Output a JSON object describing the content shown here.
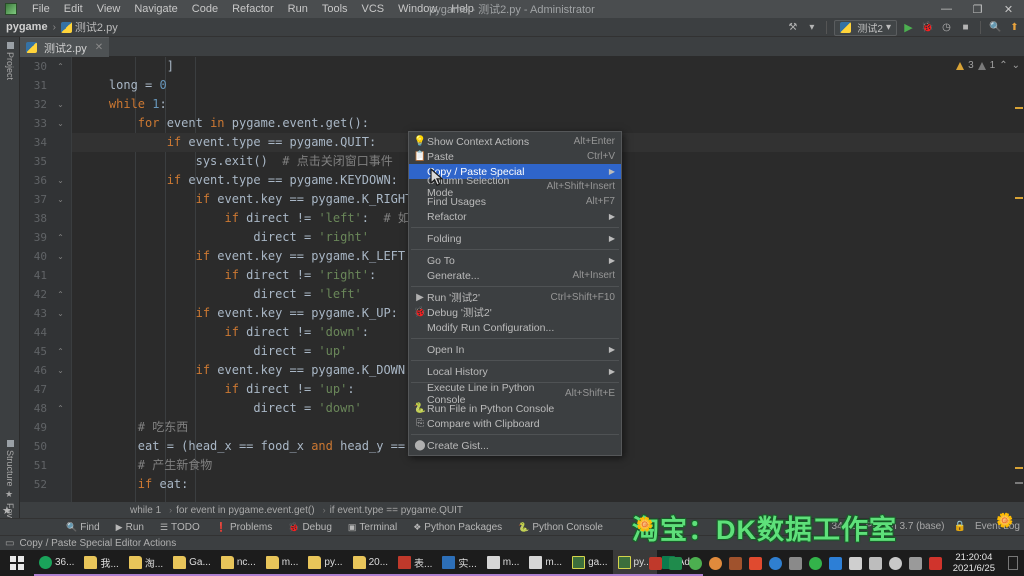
{
  "window": {
    "title": "pygame - 测试2.py - Administrator",
    "controls": {
      "minimize": "—",
      "maximize": "❐",
      "close": "✕"
    }
  },
  "menubar": {
    "items": [
      "File",
      "Edit",
      "View",
      "Navigate",
      "Code",
      "Refactor",
      "Run",
      "Tools",
      "VCS",
      "Window",
      "Help"
    ]
  },
  "breadcrumb": {
    "project": "pygame",
    "separator": "›",
    "file": "测试2.py"
  },
  "toolbar": {
    "run_config": "测试2",
    "chevron": "▾",
    "run_icon": "▶",
    "debug_icon": "🐞",
    "coverage_icon": "◷",
    "stop_icon": "■",
    "search_icon": "🔍",
    "update_icon": "⬆",
    "vcs_icon": "⚒"
  },
  "tabs": [
    {
      "label": "测试2.py",
      "close": "✕",
      "active": true
    }
  ],
  "left_tool_strip": {
    "top": "Project",
    "bottom": [
      "Structure",
      "Favorites"
    ]
  },
  "editor": {
    "inspection": {
      "warning_count": "3",
      "weak_count": "1",
      "up": "⌃",
      "down": "⌄"
    },
    "lines": [
      {
        "num": "30",
        "fold": "⌃",
        "text": "            ]"
      },
      {
        "num": "31",
        "fold": "",
        "text": "    long = 0"
      },
      {
        "num": "32",
        "fold": "⌄",
        "text": "    while 1:"
      },
      {
        "num": "33",
        "fold": "⌄",
        "text": "        for event in pygame.event.get():"
      },
      {
        "num": "34",
        "fold": "",
        "text": "            if event.type == pygame.QUIT:",
        "current": true
      },
      {
        "num": "35",
        "fold": "",
        "text": "                sys.exit()  # 点击关闭窗口事件"
      },
      {
        "num": "36",
        "fold": "⌄",
        "text": "            if event.type == pygame.KEYDOWN:   # 键"
      },
      {
        "num": "37",
        "fold": "⌄",
        "text": "                if event.key == pygame.K_RIGHT:"
      },
      {
        "num": "38",
        "fold": "",
        "text": "                    if direct != 'left':  # 如果蛇"
      },
      {
        "num": "39",
        "fold": "⌃",
        "text": "                        direct = 'right'"
      },
      {
        "num": "40",
        "fold": "⌄",
        "text": "                if event.key == pygame.K_LEFT:"
      },
      {
        "num": "41",
        "fold": "",
        "text": "                    if direct != 'right':"
      },
      {
        "num": "42",
        "fold": "⌃",
        "text": "                        direct = 'left'"
      },
      {
        "num": "43",
        "fold": "⌄",
        "text": "                if event.key == pygame.K_UP:"
      },
      {
        "num": "44",
        "fold": "",
        "text": "                    if direct != 'down':"
      },
      {
        "num": "45",
        "fold": "⌃",
        "text": "                        direct = 'up'"
      },
      {
        "num": "46",
        "fold": "⌄",
        "text": "                if event.key == pygame.K_DOWN:"
      },
      {
        "num": "47",
        "fold": "",
        "text": "                    if direct != 'up':"
      },
      {
        "num": "48",
        "fold": "⌃",
        "text": "                        direct = 'down'"
      },
      {
        "num": "49",
        "fold": "",
        "text": "        # 吃东西"
      },
      {
        "num": "50",
        "fold": "",
        "text": "        eat = (head_x == food_x and head_y == food_y)  # 是否吃到食物"
      },
      {
        "num": "51",
        "fold": "",
        "text": "        # 产生新食物"
      },
      {
        "num": "52",
        "fold": "",
        "text": "        if eat:"
      }
    ]
  },
  "context_menu": {
    "items": [
      {
        "icon": "💡",
        "label": "Show Context Actions",
        "accel": "Alt+Enter",
        "arrow": "",
        "selected": false,
        "sep_after": false
      },
      {
        "icon": "📋",
        "label": "Paste",
        "accel": "Ctrl+V",
        "arrow": "",
        "selected": false,
        "sep_after": false
      },
      {
        "icon": "",
        "label": "Copy / Paste Special",
        "accel": "",
        "arrow": "▶",
        "selected": true,
        "sep_after": false
      },
      {
        "icon": "",
        "label": "Column Selection Mode",
        "accel": "Alt+Shift+Insert",
        "arrow": "",
        "selected": false,
        "sep_after": false
      },
      {
        "icon": "",
        "label": "Find Usages",
        "accel": "Alt+F7",
        "arrow": "",
        "selected": false,
        "sep_after": false
      },
      {
        "icon": "",
        "label": "Refactor",
        "accel": "",
        "arrow": "▶",
        "selected": false,
        "sep_after": true
      },
      {
        "icon": "",
        "label": "Folding",
        "accel": "",
        "arrow": "▶",
        "selected": false,
        "sep_after": true
      },
      {
        "icon": "",
        "label": "Go To",
        "accel": "",
        "arrow": "▶",
        "selected": false,
        "sep_after": false
      },
      {
        "icon": "",
        "label": "Generate...",
        "accel": "Alt+Insert",
        "arrow": "",
        "selected": false,
        "sep_after": true
      },
      {
        "icon": "▶",
        "label": "Run '测试2'",
        "accel": "Ctrl+Shift+F10",
        "arrow": "",
        "selected": false,
        "sep_after": false
      },
      {
        "icon": "🐞",
        "label": "Debug '测试2'",
        "accel": "",
        "arrow": "",
        "selected": false,
        "sep_after": false
      },
      {
        "icon": "",
        "label": "Modify Run Configuration...",
        "accel": "",
        "arrow": "",
        "selected": false,
        "sep_after": true
      },
      {
        "icon": "",
        "label": "Open In",
        "accel": "",
        "arrow": "▶",
        "selected": false,
        "sep_after": true
      },
      {
        "icon": "",
        "label": "Local History",
        "accel": "",
        "arrow": "▶",
        "selected": false,
        "sep_after": true
      },
      {
        "icon": "",
        "label": "Execute Line in Python Console",
        "accel": "Alt+Shift+E",
        "arrow": "",
        "selected": false,
        "sep_after": false
      },
      {
        "icon": "🐍",
        "label": "Run File in Python Console",
        "accel": "",
        "arrow": "",
        "selected": false,
        "sep_after": false
      },
      {
        "icon": "⎘",
        "label": "Compare with Clipboard",
        "accel": "",
        "arrow": "",
        "selected": false,
        "sep_after": true
      },
      {
        "icon": "⬤",
        "label": "Create Gist...",
        "accel": "",
        "arrow": "",
        "selected": false,
        "sep_after": false
      }
    ]
  },
  "watermark": {
    "text": "淘宝：DK数据工作室",
    "flower": "🌼"
  },
  "bottom_breadcrumb": {
    "segments": [
      "while 1",
      "for event in pygame.event.get()",
      "if event.type == pygame.QUIT"
    ],
    "separator": "›",
    "star": "★"
  },
  "tool_buttons": [
    {
      "icon": "🔍",
      "label": "Find"
    },
    {
      "icon": "▶",
      "label": "Run"
    },
    {
      "icon": "☰",
      "label": "TODO"
    },
    {
      "icon": "❗",
      "label": "Problems"
    },
    {
      "icon": "🐞",
      "label": "Debug"
    },
    {
      "icon": "▣",
      "label": "Terminal"
    },
    {
      "icon": "❖",
      "label": "Python Packages"
    },
    {
      "icon": "🐍",
      "label": "Python Console"
    }
  ],
  "status": {
    "hint": "Copy / Paste Special Editor Actions",
    "hint_icon": "▭",
    "caret": "34:38",
    "interpreter": "Python 3.7 (base)",
    "lock_icon": "🔒",
    "event_log": "Event Log"
  },
  "taskbar": {
    "items": [
      {
        "label": "36...",
        "icon_color": "#1aa35a",
        "type": "browser"
      },
      {
        "label": "我...",
        "icon_color": "#e8c55a",
        "type": "folder"
      },
      {
        "label": "淘...",
        "icon_color": "#e8c55a",
        "type": "folder"
      },
      {
        "label": "Ga...",
        "icon_color": "#e8c55a",
        "type": "folder"
      },
      {
        "label": "nc...",
        "icon_color": "#e8c55a",
        "type": "folder"
      },
      {
        "label": "m...",
        "icon_color": "#e8c55a",
        "type": "folder"
      },
      {
        "label": "py...",
        "icon_color": "#e8c55a",
        "type": "folder"
      },
      {
        "label": "20...",
        "icon_color": "#e8c55a",
        "type": "folder"
      },
      {
        "label": "表...",
        "icon_color": "#c0392b",
        "type": "app"
      },
      {
        "label": "实...",
        "icon_color": "#2d6fb8",
        "type": "app"
      },
      {
        "label": "m...",
        "icon_color": "#d6d6d6",
        "type": "doc"
      },
      {
        "label": "m...",
        "icon_color": "#d6d6d6",
        "type": "doc"
      },
      {
        "label": "ga...",
        "icon_color": "#3c6e3c",
        "type": "pycharm"
      },
      {
        "label": "py...",
        "icon_color": "#3c6e3c",
        "type": "pycharm",
        "active": true
      },
      {
        "label": "Ad...",
        "icon_color": "#0c7a4d",
        "type": "cp"
      }
    ],
    "clock_time": "21:20:04",
    "clock_date": "2021/6/25"
  }
}
